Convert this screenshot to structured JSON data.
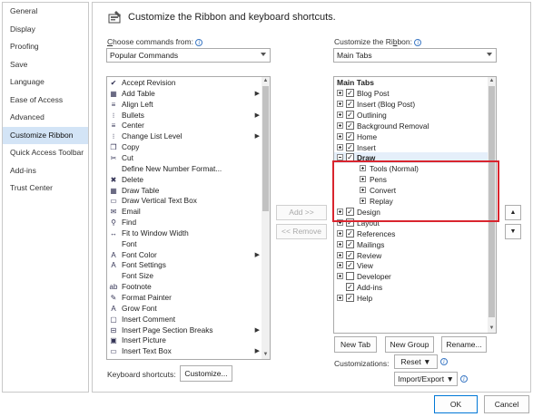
{
  "sidebar": {
    "items": [
      {
        "label": "General"
      },
      {
        "label": "Display"
      },
      {
        "label": "Proofing"
      },
      {
        "label": "Save"
      },
      {
        "label": "Language"
      },
      {
        "label": "Ease of Access"
      },
      {
        "label": "Advanced"
      },
      {
        "label": "Customize Ribbon"
      },
      {
        "label": "Quick Access Toolbar"
      },
      {
        "label": "Add-ins"
      },
      {
        "label": "Trust Center"
      }
    ],
    "selected": "Customize Ribbon"
  },
  "header": {
    "title": "Customize the Ribbon and keyboard shortcuts."
  },
  "left": {
    "label_pre": "",
    "label_ul": "C",
    "label_post": "hoose commands from:",
    "dropdown_value": "Popular Commands",
    "commands": [
      {
        "label": "Accept Revision",
        "icon": "accept-icon",
        "glyph": "✔"
      },
      {
        "label": "Add Table",
        "icon": "table-icon",
        "glyph": "▦",
        "sub": "▶"
      },
      {
        "label": "Align Left",
        "icon": "align-left-icon",
        "glyph": "≡"
      },
      {
        "label": "Bullets",
        "icon": "bullets-icon",
        "glyph": "⁝",
        "sub": "▶"
      },
      {
        "label": "Center",
        "icon": "center-icon",
        "glyph": "≡"
      },
      {
        "label": "Change List Level",
        "icon": "list-level-icon",
        "glyph": "⁝",
        "sub": "▶"
      },
      {
        "label": "Copy",
        "icon": "copy-icon",
        "glyph": "❐"
      },
      {
        "label": "Cut",
        "icon": "cut-icon",
        "glyph": "✂"
      },
      {
        "label": "Define New Number Format...",
        "icon": "",
        "glyph": ""
      },
      {
        "label": "Delete",
        "icon": "delete-icon",
        "glyph": "✖"
      },
      {
        "label": "Draw Table",
        "icon": "draw-table-icon",
        "glyph": "▦"
      },
      {
        "label": "Draw Vertical Text Box",
        "icon": "text-box-icon",
        "glyph": "▭"
      },
      {
        "label": "Email",
        "icon": "email-icon",
        "glyph": "✉"
      },
      {
        "label": "Find",
        "icon": "find-icon",
        "glyph": "⚲"
      },
      {
        "label": "Fit to Window Width",
        "icon": "fit-width-icon",
        "glyph": "↔"
      },
      {
        "label": "Font",
        "icon": "",
        "glyph": "",
        "sub2": "I"
      },
      {
        "label": "Font Color",
        "icon": "font-color-icon",
        "glyph": "A",
        "sub": "▶"
      },
      {
        "label": "Font Settings",
        "icon": "font-settings-icon",
        "glyph": "A"
      },
      {
        "label": "Font Size",
        "icon": "",
        "glyph": "",
        "sub2": "I"
      },
      {
        "label": "Footnote",
        "icon": "footnote-icon",
        "glyph": "ab"
      },
      {
        "label": "Format Painter",
        "icon": "format-painter-icon",
        "glyph": "✎"
      },
      {
        "label": "Grow Font",
        "icon": "grow-font-icon",
        "glyph": "A"
      },
      {
        "label": "Insert Comment",
        "icon": "comment-icon",
        "glyph": "▢"
      },
      {
        "label": "Insert Page  Section Breaks",
        "icon": "breaks-icon",
        "glyph": "⊟",
        "sub": "▶"
      },
      {
        "label": "Insert Picture",
        "icon": "picture-icon",
        "glyph": "▣"
      },
      {
        "label": "Insert Text Box",
        "icon": "insert-textbox-icon",
        "glyph": "▭",
        "sub": "▶"
      }
    ],
    "shortcuts_label": "Keyboard shortcuts:",
    "customize_btn": "Customize..."
  },
  "middle": {
    "add_btn": "Add >>",
    "remove_btn": "<< Remove"
  },
  "right": {
    "label_pre": "Customize the Ri",
    "label_ul": "b",
    "label_post": "bon:",
    "dropdown_value": "Main Tabs",
    "header": "Main Tabs",
    "tabs": [
      {
        "label": "Blog Post",
        "checked": true,
        "exp": "⊞",
        "level": 0
      },
      {
        "label": "Insert (Blog Post)",
        "checked": true,
        "exp": "⊞",
        "level": 0
      },
      {
        "label": "Outlining",
        "checked": true,
        "exp": "⊞",
        "level": 0
      },
      {
        "label": "Background Removal",
        "checked": true,
        "exp": "⊞",
        "level": 0
      },
      {
        "label": "Home",
        "checked": true,
        "exp": "⊞",
        "level": 0
      },
      {
        "label": "Insert",
        "checked": true,
        "exp": "⊞",
        "level": 0
      },
      {
        "label": "Draw",
        "checked": true,
        "exp": "⊟",
        "level": 0,
        "selected": true
      },
      {
        "label": "Tools (Normal)",
        "exp": "⊞",
        "level": 1
      },
      {
        "label": "Pens",
        "exp": "⊞",
        "level": 1
      },
      {
        "label": "Convert",
        "exp": "⊞",
        "level": 1
      },
      {
        "label": "Replay",
        "exp": "⊞",
        "level": 1
      },
      {
        "label": "Design",
        "checked": true,
        "exp": "⊞",
        "level": 0
      },
      {
        "label": "Layout",
        "checked": true,
        "exp": "⊞",
        "level": 0
      },
      {
        "label": "References",
        "checked": true,
        "exp": "⊞",
        "level": 0
      },
      {
        "label": "Mailings",
        "checked": true,
        "exp": "⊞",
        "level": 0
      },
      {
        "label": "Review",
        "checked": true,
        "exp": "⊞",
        "level": 0
      },
      {
        "label": "View",
        "checked": true,
        "exp": "⊞",
        "level": 0
      },
      {
        "label": "Developer",
        "checked": false,
        "exp": "⊞",
        "level": 0
      },
      {
        "label": "Add-ins",
        "checked": true,
        "exp": "",
        "level": 0
      },
      {
        "label": "Help",
        "checked": true,
        "exp": "⊞",
        "level": 0
      }
    ],
    "new_tab_btn": "New Tab",
    "new_group_btn": "New Group",
    "rename_btn": "Rename...",
    "customizations_label": "Customizations:",
    "reset_btn": "Reset ▼",
    "import_export_btn": "Import/Export ▼"
  },
  "footer": {
    "ok_btn": "OK",
    "cancel_btn": "Cancel"
  }
}
